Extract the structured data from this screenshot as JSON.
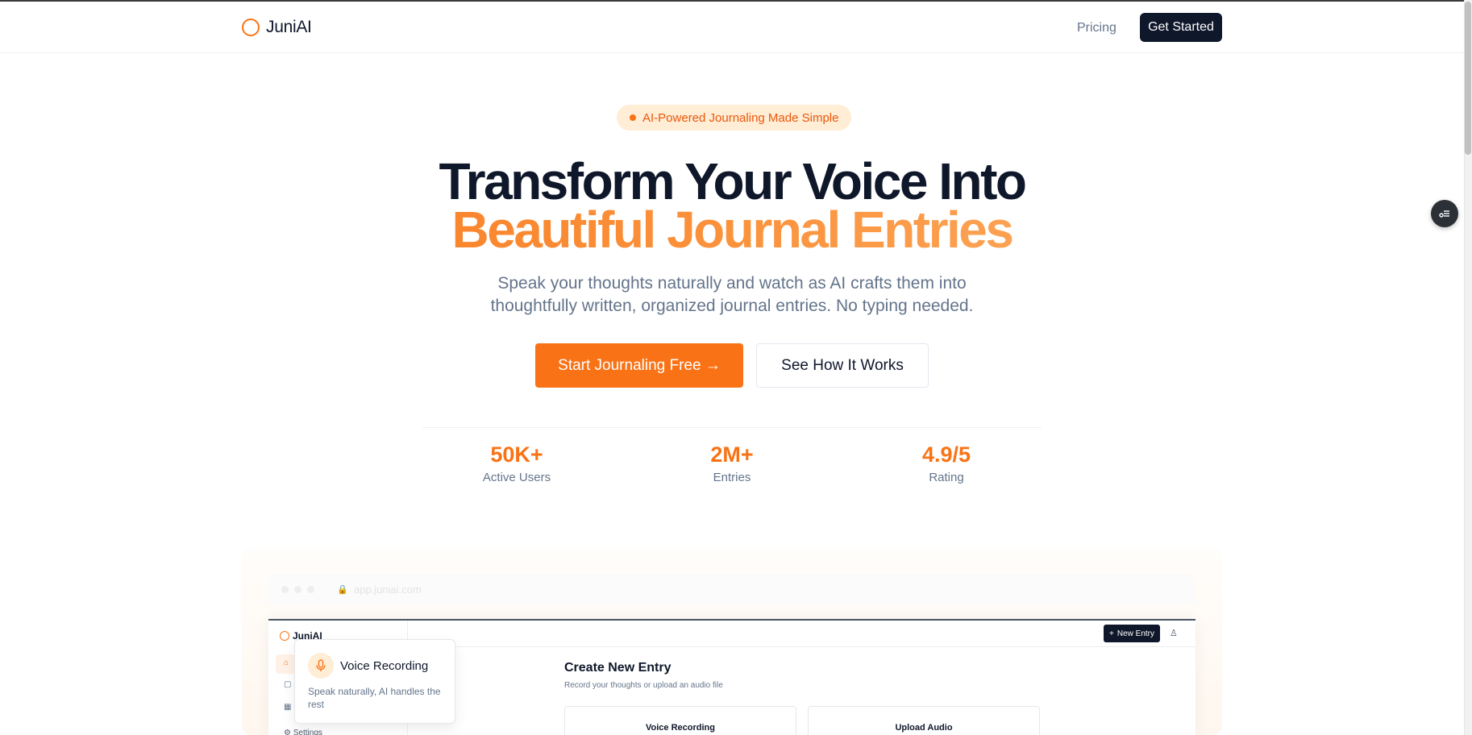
{
  "brand": {
    "name": "JuniAI",
    "accent": "#f97316",
    "dark": "#0f172a"
  },
  "nav": {
    "pricing": "Pricing",
    "get_started": "Get Started"
  },
  "hero": {
    "badge": "AI-Powered Journaling Made Simple",
    "title_line1": "Transform Your Voice Into",
    "title_line2": "Beautiful Journal Entries",
    "subtitle_line1": "Speak your thoughts naturally and watch as AI crafts them into",
    "subtitle_line2": "thoughtfully written, organized journal entries. No typing needed.",
    "cta_primary": "Start Journaling Free →",
    "cta_secondary": "See How It Works"
  },
  "stats": [
    {
      "value": "50K+",
      "label": "Active Users"
    },
    {
      "value": "2M+",
      "label": "Entries"
    },
    {
      "value": "4.9/5",
      "label": "Rating"
    }
  ],
  "preview": {
    "url": "app.juniai.com",
    "app_name": "JuniAI",
    "new_entry": "New Entry",
    "settings": "Settings",
    "page_title": "Create New Entry",
    "page_subtitle": "Record your thoughts or upload an audio file",
    "card_voice": "Voice Recording",
    "card_upload": "Upload Audio",
    "tooltip_title": "Voice Recording",
    "tooltip_desc": "Speak naturally, AI handles the rest"
  },
  "icons": {
    "logo": "ring-logo-icon",
    "side_button": "settings-sliders-icon",
    "mic": "microphone-icon"
  }
}
